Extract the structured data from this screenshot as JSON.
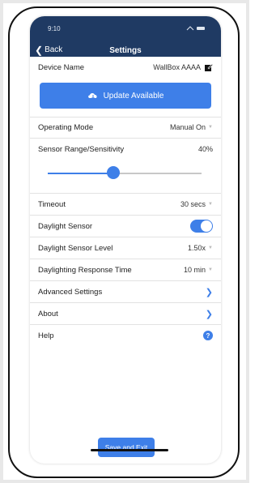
{
  "status": {
    "time": "9:10",
    "icons": "•••  ▬"
  },
  "nav": {
    "back_label": "Back",
    "title": "Settings"
  },
  "device": {
    "label": "Device Name",
    "value": "WallBox AAAA"
  },
  "update": {
    "label": "Update Available"
  },
  "operating_mode": {
    "label": "Operating Mode",
    "value": "Manual On"
  },
  "sensor_range": {
    "label": "Sensor Range/Sensitivity",
    "value": "40%",
    "level": 0.4
  },
  "timeout": {
    "label": "Timeout",
    "value": "30 secs"
  },
  "daylight_sensor": {
    "label": "Daylight Sensor",
    "enabled": true
  },
  "daylight_level": {
    "label": "Daylight Sensor Level",
    "value": "1.50x"
  },
  "response_time": {
    "label": "Daylighting Response Time",
    "value": "10 min"
  },
  "advanced": {
    "label": "Advanced Settings"
  },
  "about": {
    "label": "About"
  },
  "help": {
    "label": "Help"
  },
  "save": {
    "label": "Save and Exit"
  },
  "colors": {
    "nav_bg": "#1f3a63",
    "accent": "#3e7fe8"
  }
}
